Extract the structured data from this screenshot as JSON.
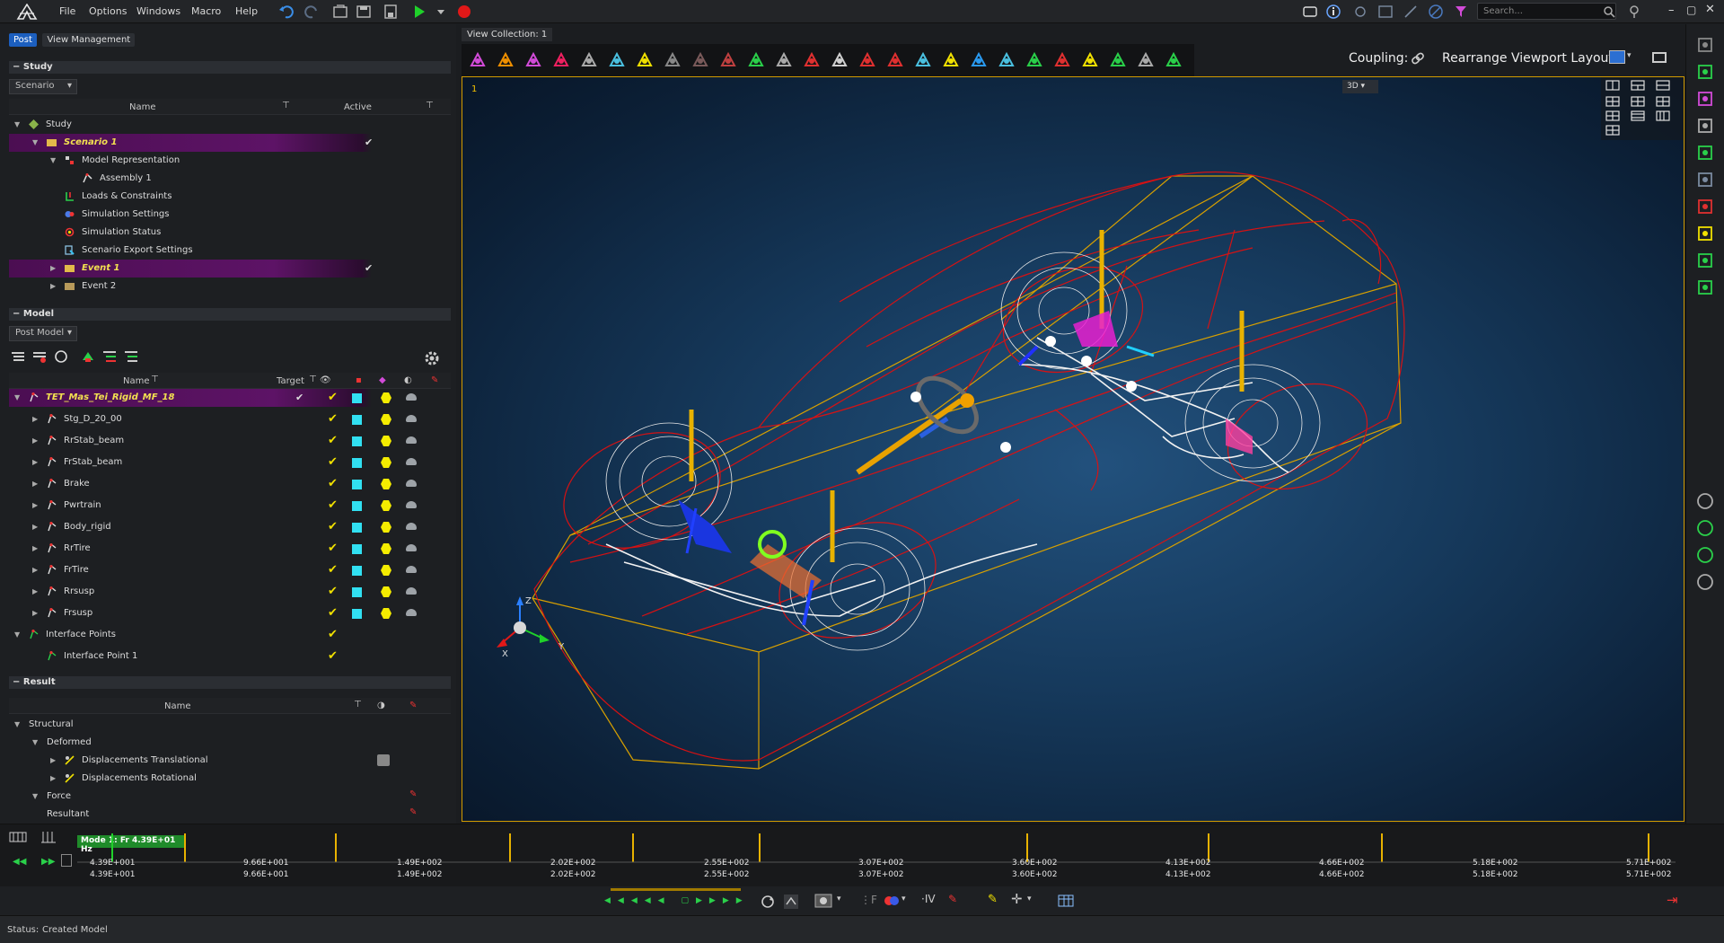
{
  "menu": {
    "file": "File",
    "options": "Options",
    "windows": "Windows",
    "macro": "Macro",
    "help": "Help"
  },
  "search": {
    "placeholder": "Search..."
  },
  "left_tabs": {
    "post": "Post",
    "view_management": "View Management"
  },
  "study": {
    "section_title": "Study",
    "dropdown": "Scenario",
    "col_name": "Name",
    "col_active": "Active",
    "rows": [
      {
        "label": "Study"
      },
      {
        "label": "Scenario 1"
      },
      {
        "label": "Model Representation"
      },
      {
        "label": "Assembly 1"
      },
      {
        "label": "Loads & Constraints"
      },
      {
        "label": "Simulation Settings"
      },
      {
        "label": "Simulation Status"
      },
      {
        "label": "Scenario Export Settings"
      },
      {
        "label": "Event 1"
      },
      {
        "label": "Event 2"
      }
    ]
  },
  "model": {
    "section_title": "Model",
    "dropdown": "Post Model",
    "col_name": "Name",
    "col_target": "Target",
    "rows": [
      {
        "label": "TET_Mas_Tei_Rigid_MF_18"
      },
      {
        "label": "Stg_D_20_00"
      },
      {
        "label": "RrStab_beam"
      },
      {
        "label": "FrStab_beam"
      },
      {
        "label": "Brake"
      },
      {
        "label": "Pwrtrain"
      },
      {
        "label": "Body_rigid"
      },
      {
        "label": "RrTire"
      },
      {
        "label": "FrTire"
      },
      {
        "label": "Rrsusp"
      },
      {
        "label": "Frsusp"
      },
      {
        "label": "Interface Points"
      },
      {
        "label": "Interface Point 1"
      }
    ]
  },
  "result": {
    "section_title": "Result",
    "col_name": "Name",
    "rows": [
      {
        "label": "Structural"
      },
      {
        "label": "Deformed"
      },
      {
        "label": "Displacements Translational"
      },
      {
        "label": "Displacements Rotational"
      },
      {
        "label": "Force"
      },
      {
        "label": "Resultant"
      }
    ]
  },
  "viewport": {
    "collection_label": "View Collection: 1",
    "coupling_label": "Coupling:",
    "rearrange_label": "Rearrange Viewport Layout:",
    "viewport_number": "1",
    "view_mode": "3D",
    "axis_x": "X",
    "axis_y": "Y",
    "axis_z": "Z"
  },
  "timeline": {
    "mode_label": "Mode 1: Fr 4.39E+01 Hz",
    "ticks": [
      "4.39E+001",
      "9.66E+001",
      "1.49E+002",
      "2.02E+002",
      "2.55E+002",
      "3.07E+002",
      "3.60E+002",
      "4.13E+002",
      "4.66E+002",
      "5.18E+002",
      "5.71E+002"
    ]
  },
  "status": {
    "label": "Status:",
    "text": "Created Model"
  },
  "colors": {
    "accent": "#d29b00",
    "highlight": "#5d1366",
    "check": "#f0e000",
    "cyan": "#31e0f2",
    "wire_red": "#e01010"
  }
}
